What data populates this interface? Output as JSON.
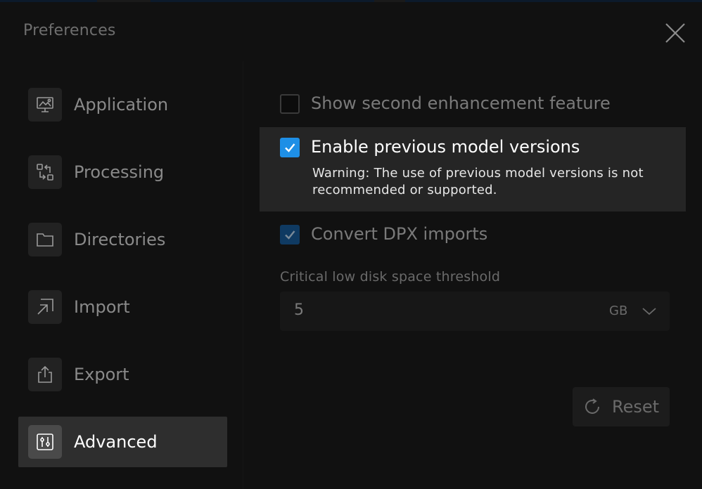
{
  "dialog": {
    "title": "Preferences"
  },
  "sidebar": {
    "items": [
      {
        "label": "Application",
        "icon": "monitor-settings-icon",
        "active": false
      },
      {
        "label": "Processing",
        "icon": "swap-arrows-icon",
        "active": false
      },
      {
        "label": "Directories",
        "icon": "folder-icon",
        "active": false
      },
      {
        "label": "Import",
        "icon": "import-arrow-icon",
        "active": false
      },
      {
        "label": "Export",
        "icon": "export-share-icon",
        "active": false
      },
      {
        "label": "Advanced",
        "icon": "sliders-icon",
        "active": true
      }
    ]
  },
  "advanced": {
    "options": [
      {
        "label": "Show second enhancement feature",
        "checked": false
      },
      {
        "label": "Enable previous model versions",
        "checked": true,
        "warning": "Warning: The use of previous model versions is not recommended or supported."
      },
      {
        "label": "Convert DPX imports",
        "checked": true
      }
    ],
    "disk_threshold": {
      "label": "Critical low disk space threshold",
      "value": "5",
      "unit": "GB"
    },
    "reset_label": "Reset"
  },
  "colors": {
    "accent": "#1e8fe6",
    "background": "#111111",
    "active_item": "#2e2e2e"
  }
}
